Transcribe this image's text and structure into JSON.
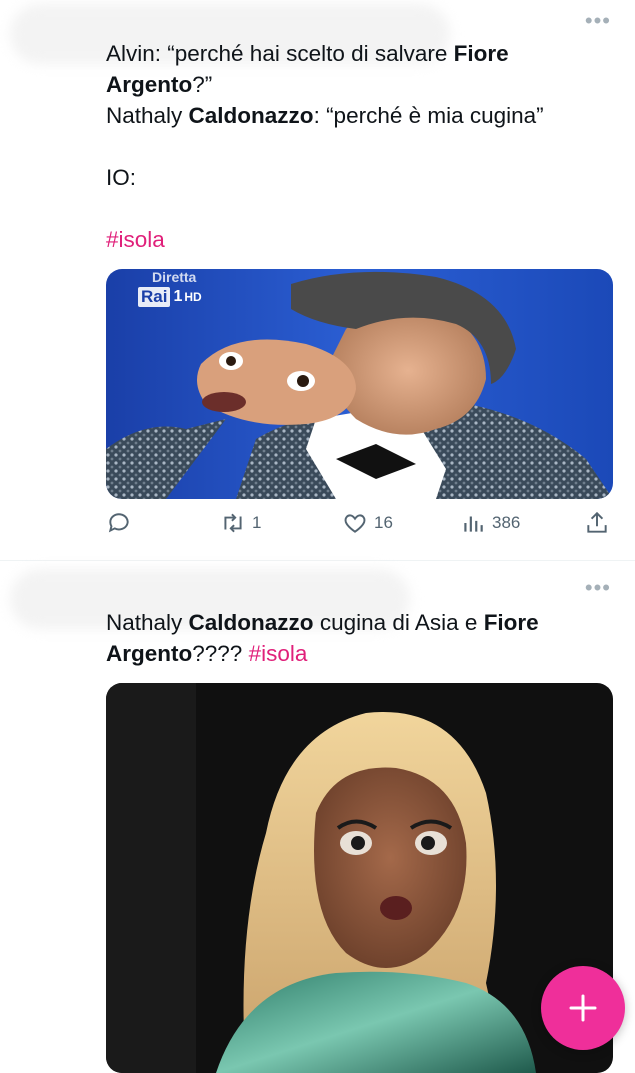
{
  "tweets": [
    {
      "lines": [
        {
          "segments": [
            {
              "text": "Alvin: “perché hai scelto di salvare ",
              "bold": false
            },
            {
              "text": "Fiore Argento",
              "bold": true
            },
            {
              "text": "?”",
              "bold": false
            }
          ]
        },
        {
          "segments": [
            {
              "text": "Nathaly ",
              "bold": false
            },
            {
              "text": "Caldonazzo",
              "bold": true
            },
            {
              "text": ": “perché è mia cugina”",
              "bold": false
            }
          ]
        },
        {
          "segments": [
            {
              "text": "IO:",
              "bold": false
            }
          ]
        },
        {
          "segments": [
            {
              "text": "#isola",
              "tag": true
            }
          ]
        }
      ],
      "media": {
        "overlay_text": "Diretta",
        "channel_logo": "Rai",
        "channel_number": "1",
        "channel_hd": "HD"
      },
      "actions": {
        "replies": "",
        "retweets": "1",
        "likes": "16",
        "views": "386"
      }
    },
    {
      "lines": [
        {
          "segments": [
            {
              "text": "Nathaly ",
              "bold": false
            },
            {
              "text": "Caldonazzo",
              "bold": true
            },
            {
              "text": " cugina di Asia e ",
              "bold": false
            },
            {
              "text": "Fiore Argento",
              "bold": true
            },
            {
              "text": "???? ",
              "bold": false
            },
            {
              "text": "#isola",
              "tag": true
            }
          ]
        }
      ]
    }
  ],
  "fab": {
    "label": "+"
  },
  "colors": {
    "accent": "#e0207a",
    "fab": "#ef2f9a",
    "icon": "#536471"
  },
  "icons": [
    "more-icon",
    "reply-icon",
    "retweet-icon",
    "like-icon",
    "views-icon",
    "share-icon",
    "plus-icon"
  ]
}
